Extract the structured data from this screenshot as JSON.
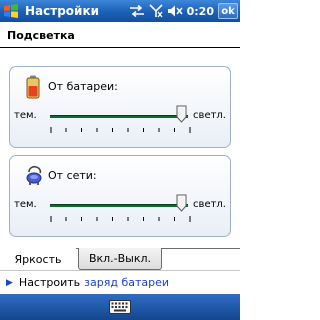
{
  "titlebar": {
    "title": "Настройки",
    "time": "0:20",
    "ok_label": "ok",
    "icons": [
      "windows-start-icon",
      "connectivity-icon",
      "signal-off-icon",
      "volume-mute-icon"
    ]
  },
  "header": {
    "title": "Подсветка"
  },
  "battery": {
    "label": "От батареи:",
    "left_label": "тем.",
    "right_label": "светл.",
    "level": 1.0,
    "icon": "battery-icon"
  },
  "external": {
    "label": "От сети:",
    "left_label": "тем.",
    "right_label": "светл.",
    "level": 1.0,
    "icon": "power-plug-icon"
  },
  "tabs": [
    {
      "label": "Яркость",
      "active": true
    },
    {
      "label": "Вкл.-Выкл.",
      "active": false
    }
  ],
  "link_row": {
    "static_text": "Настроить",
    "link_text": "заряд батареи"
  },
  "menubar": {
    "icon": "keyboard-icon"
  },
  "colors": {
    "titlebar": "#1c5fb8",
    "track": "#0d6b2e",
    "link": "#1b3fd6"
  }
}
